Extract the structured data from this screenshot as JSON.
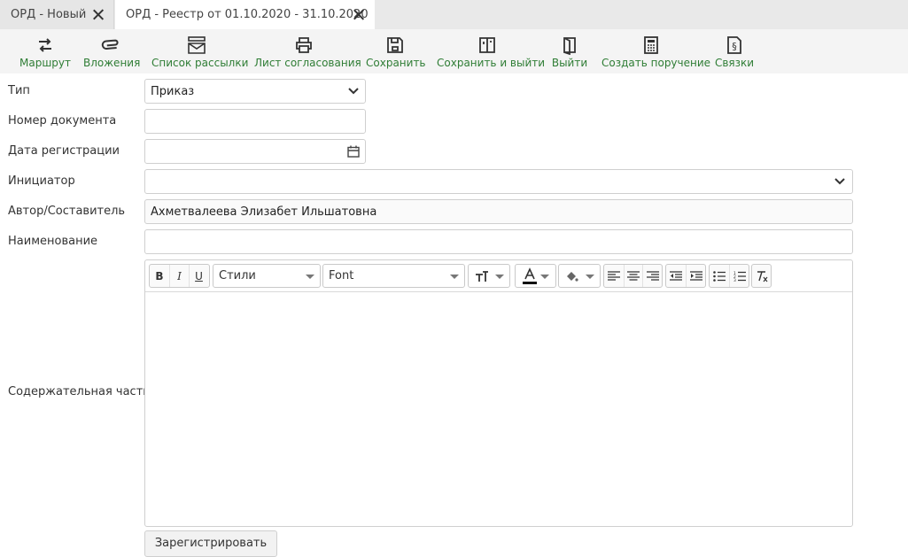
{
  "tabs": [
    {
      "label": "ОРД - Новый"
    },
    {
      "label": "ОРД - Реестр от 01.10.2020 - 31.10.2020"
    }
  ],
  "toolbar": {
    "items": [
      {
        "label": "Маршрут",
        "icon": "route-icon"
      },
      {
        "label": "Вложения",
        "icon": "paperclip-icon"
      },
      {
        "label": "Список рассылки",
        "icon": "mail-list-icon"
      },
      {
        "label": "Лист согласования",
        "icon": "print-icon"
      },
      {
        "label": "Сохранить",
        "icon": "save-icon"
      },
      {
        "label": "Сохранить и выйти",
        "icon": "save-exit-icon"
      },
      {
        "label": "Выйти",
        "icon": "exit-icon"
      },
      {
        "label": "Создать поручение",
        "icon": "calculator-icon"
      },
      {
        "label": "Связки",
        "icon": "document-link-icon"
      }
    ],
    "accent_color": "#2f7d35"
  },
  "form": {
    "type": {
      "label": "Тип",
      "value": "Приказ"
    },
    "doc_number": {
      "label": "Номер документа",
      "value": ""
    },
    "reg_date": {
      "label": "Дата регистрации",
      "value": ""
    },
    "initiator": {
      "label": "Инициатор",
      "value": ""
    },
    "author": {
      "label": "Автор/Составитель",
      "value": "Ахметвалеева Элизабет Ильшатовна"
    },
    "name": {
      "label": "Наименование",
      "value": ""
    },
    "content": {
      "label": "Содержательная часть",
      "value": ""
    }
  },
  "editor": {
    "styles_combo": "Стили",
    "font_combo": "Font"
  },
  "register_button": "Зарегистрировать"
}
